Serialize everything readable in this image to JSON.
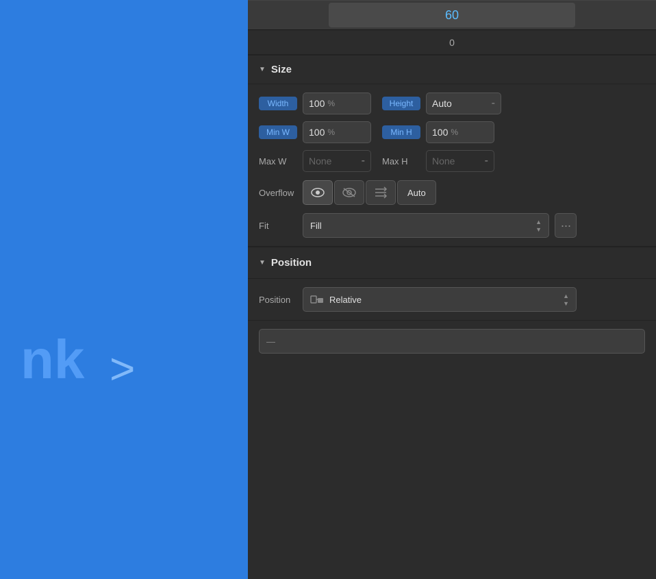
{
  "canvas": {
    "text": "nk",
    "arrow": ">"
  },
  "top": {
    "value": "60",
    "zero": "0"
  },
  "size_section": {
    "title": "Size",
    "triangle": "▼"
  },
  "width_label": "Width",
  "width_value": "100",
  "width_unit": "%",
  "height_label": "Height",
  "height_value": "Auto",
  "height_dash": "-",
  "minw_label": "Min W",
  "minw_value": "100",
  "minw_unit": "%",
  "minh_label": "Min H",
  "minh_value": "100",
  "minh_unit": "%",
  "maxw_label": "Max W",
  "maxw_value": "None",
  "maxw_dash": "-",
  "maxh_label": "Max H",
  "maxh_value": "None",
  "maxh_dash": "-",
  "overflow_label": "Overflow",
  "overflow_auto": "Auto",
  "fit_label": "Fit",
  "fit_value": "Fill",
  "fit_more": "···",
  "position_section": {
    "title": "Position",
    "triangle": "▼"
  },
  "position_label": "Position",
  "position_value": "Relative",
  "icons": {
    "eye": "👁",
    "eye_slash": "⊘",
    "list": "≡↑",
    "chevron_up": "▲",
    "chevron_down": "▼"
  }
}
